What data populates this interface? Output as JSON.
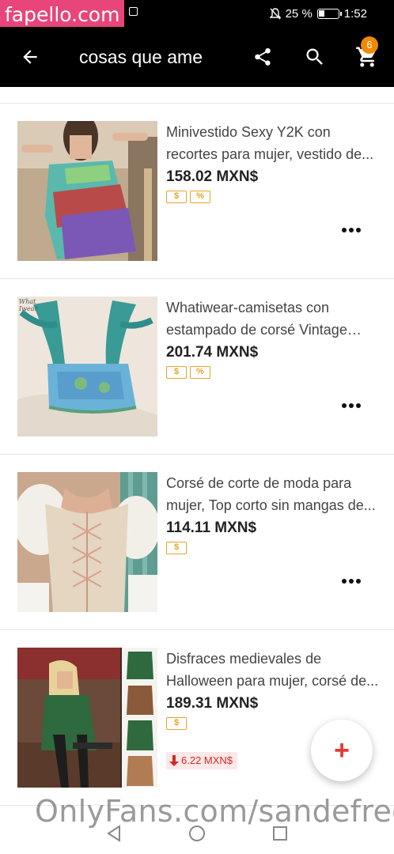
{
  "status_bar": {
    "watermark": "fapello.com",
    "battery_percent": "25 %",
    "time": "1:52"
  },
  "app_bar": {
    "title": "cosas que ame",
    "cart_count": "6",
    "icons": [
      "back-arrow-icon",
      "share-icon",
      "search-icon",
      "cart-icon"
    ]
  },
  "items": [
    {
      "title": "Minivestido Sexy Y2K con recortes para mujer, vestido de...",
      "price": "158.02 MXN$",
      "tags": [
        "$",
        "%"
      ]
    },
    {
      "title": "Whatiwear-camisetas con estampado de corsé Vintage para...",
      "price": "201.74 MXN$",
      "tags": [
        "$",
        "%"
      ],
      "image_text": "What Iwear"
    },
    {
      "title": "Corsé de corte de moda para mujer, Top corto sin mangas de...",
      "price": "114.11 MXN$",
      "tags": [
        "$"
      ]
    },
    {
      "title": "Disfraces medievales de Halloween para mujer, corsé de...",
      "price": "189.31 MXN$",
      "tags": [
        "$"
      ],
      "price_drop": "6.22 MXN$"
    }
  ],
  "fab": {
    "label": "+"
  },
  "watermark_bottom": "OnlyFans.com/sandefree",
  "colors": {
    "accent": "#e53935",
    "badge": "#f08a00",
    "tag": "#e7a32a"
  }
}
